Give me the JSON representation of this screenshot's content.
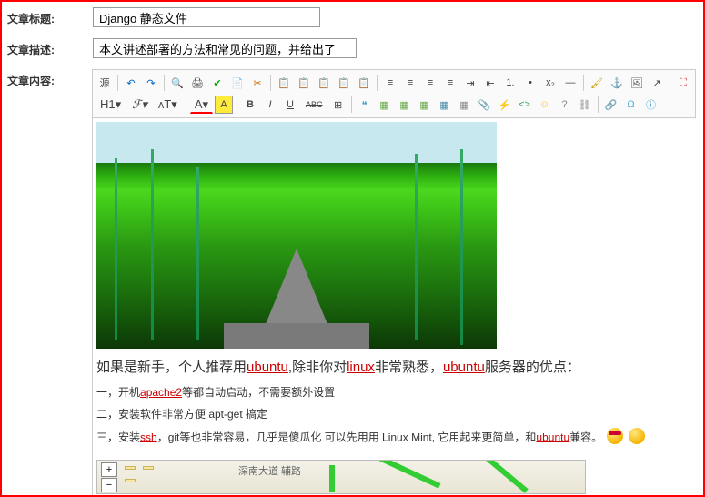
{
  "labels": {
    "title": "文章标题:",
    "desc": "文章描述:",
    "content": "文章内容:"
  },
  "fields": {
    "title_value": "Django 静态文件",
    "desc_value": "本文讲述部署的方法和常见的问题，并给出了"
  },
  "toolbar": {
    "row1": {
      "source": "源",
      "undo": "↶",
      "redo": "↷",
      "find": "🔍",
      "print": "🖨",
      "spell": "✔",
      "preview": "📄",
      "cut": "✂",
      "copy": "📋",
      "paste1": "📋",
      "paste2": "📋",
      "paste3": "📋",
      "paste4": "📋",
      "align_l": "≡",
      "align_c": "≡",
      "align_r": "≡",
      "align_j": "≡",
      "indent_in": "⇥",
      "indent_out": "⇤",
      "list_num": "1.",
      "list_bul": "•",
      "sub": "x₂",
      "hr": "—",
      "clean": "🖌",
      "anchor": "⚓",
      "img": "🖼",
      "arrow": "↗",
      "maximize": "⛶"
    },
    "row2": {
      "h1": "H1▾",
      "font": "ℱ▾",
      "size": "ᴀT▾",
      "color": "A▾",
      "bg": "A",
      "bold": "B",
      "italic": "I",
      "underline": "U",
      "strike": "ABC",
      "reset": "⊞",
      "quote": "❝",
      "obj1": "▦",
      "obj2": "▦",
      "obj3": "▦",
      "table": "▦",
      "iframe": "▦",
      "attach": "📎",
      "flash": "⚡",
      "code": "<>",
      "smile": "☺",
      "help": "?",
      "unlink": "⛓",
      "link": "🔗",
      "char": "Ω",
      "about": "ⓘ"
    }
  },
  "article": {
    "p1_a": "如果是新手，个人推荐用",
    "p1_ubuntu": "ubuntu",
    "p1_b": ",除非你对",
    "p1_linux": "linux",
    "p1_c": "非常熟悉，",
    "p1_d": "服务器的优点：",
    "p2_a": "一，开机",
    "p2_apache": "apache2",
    "p2_b": "等都自动启动，不需要额外设置",
    "p3": "二，安装软件非常方便 apt-get 搞定",
    "p4_a": "三，安装",
    "p4_ssh": "ssh",
    "p4_b": "，git等也非常容易，几乎是傻瓜化 可以先用用 Linux Mint, 它用起来更简单，和",
    "p4_ubuntu": "ubuntu",
    "p4_c": "兼容。"
  },
  "map": {
    "plus": "+",
    "minus": "−",
    "road_name": "深南大道 辅路"
  }
}
